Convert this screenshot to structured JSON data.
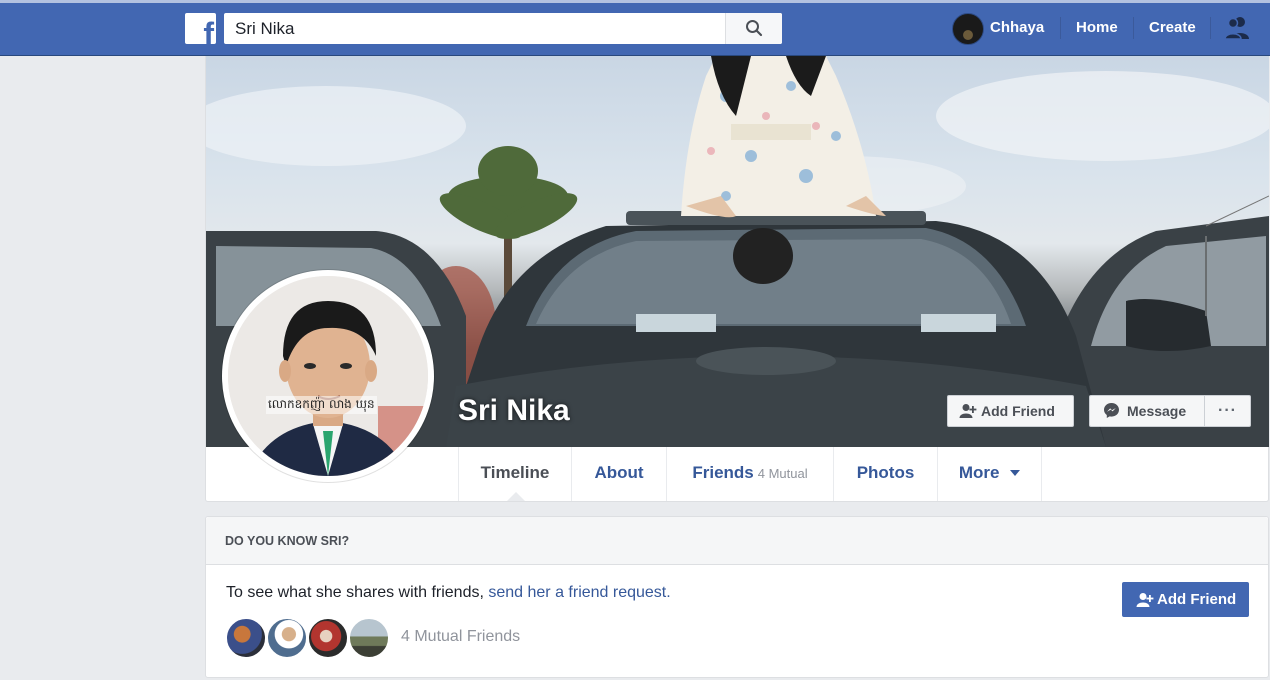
{
  "header": {
    "search_value": "Sri Nika",
    "user_name": "Chhaya",
    "home_label": "Home",
    "create_label": "Create"
  },
  "profile": {
    "name": "Sri Nika",
    "photo_caption": "លោកឧកញ៉ា លាង ឃុន",
    "add_friend_label": "Add Friend",
    "message_label": "Message",
    "more_options": "···"
  },
  "tabs": [
    {
      "label": "Timeline",
      "sub": ""
    },
    {
      "label": "About",
      "sub": ""
    },
    {
      "label": "Friends",
      "sub": "4 Mutual"
    },
    {
      "label": "Photos",
      "sub": ""
    },
    {
      "label": "More",
      "sub": ""
    }
  ],
  "know": {
    "title": "DO YOU KNOW SRI?",
    "text_prefix": "To see what she shares with friends, ",
    "text_link": "send her a friend request.",
    "mutual_friends": "4 Mutual Friends",
    "add_friend_label": "Add Friend"
  },
  "colors": {
    "brand": "#4267b2",
    "link": "#365899"
  }
}
